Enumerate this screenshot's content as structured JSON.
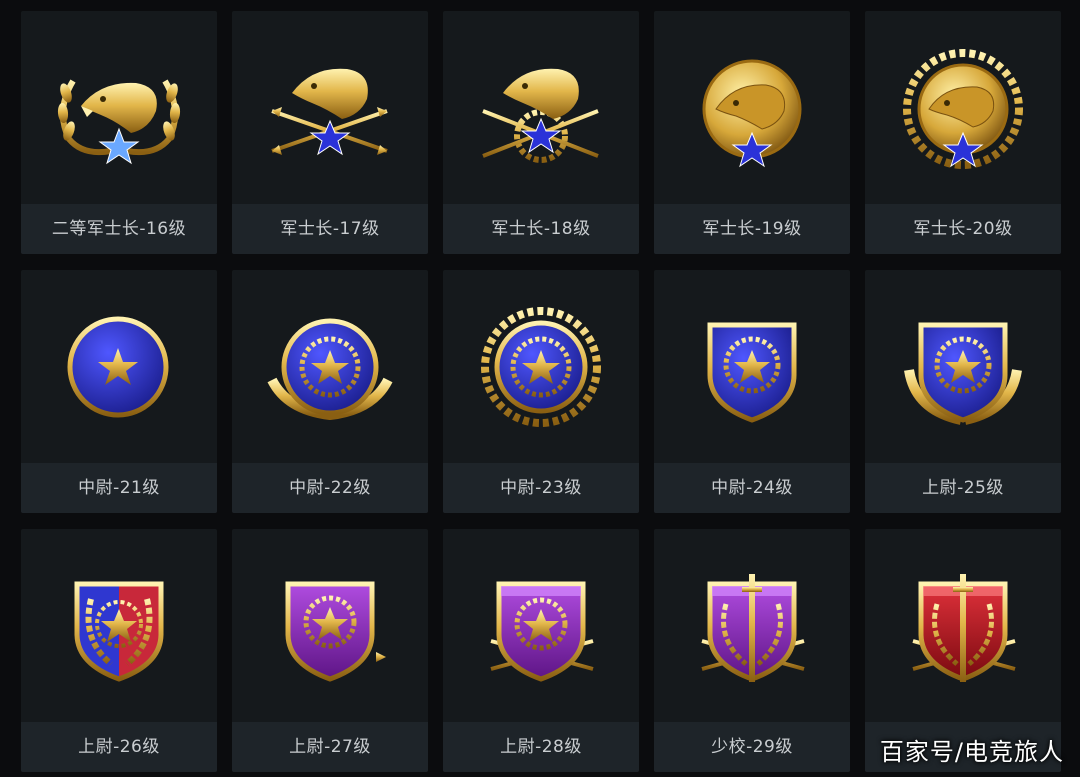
{
  "ranks": [
    {
      "label": "二等军士长-16级",
      "icon": "eagle-wreath-badge-icon"
    },
    {
      "label": "军士长-17级",
      "icon": "eagle-arrows-badge-icon"
    },
    {
      "label": "军士长-18级",
      "icon": "eagle-arrows-gear-badge-icon"
    },
    {
      "label": "军士长-19级",
      "icon": "eagle-gold-coin-badge-icon"
    },
    {
      "label": "军士长-20级",
      "icon": "eagle-gold-wreath-badge-icon"
    },
    {
      "label": "中尉-21级",
      "icon": "blue-circle-star-badge-icon"
    },
    {
      "label": "中尉-22级",
      "icon": "blue-circle-gear-wings-badge-icon"
    },
    {
      "label": "中尉-23级",
      "icon": "blue-circle-gear-wreath-badge-icon"
    },
    {
      "label": "中尉-24级",
      "icon": "blue-shield-gear-badge-icon"
    },
    {
      "label": "上尉-25级",
      "icon": "blue-shield-gear-wings-badge-icon"
    },
    {
      "label": "上尉-26级",
      "icon": "split-shield-wreath-badge-icon"
    },
    {
      "label": "上尉-27级",
      "icon": "purple-shield-arrow-badge-icon"
    },
    {
      "label": "上尉-28级",
      "icon": "purple-castle-shield-arrows-badge-icon"
    },
    {
      "label": "少校-29级",
      "icon": "purple-sword-shield-badge-icon"
    },
    {
      "label": "",
      "icon": "red-sword-shield-badge-icon"
    }
  ],
  "watermark": "百家号/电竞旅人",
  "colors": {
    "background": "#0b0c0e",
    "card": "#15191c",
    "label_bar": "#1e2429",
    "gold": "#e2b64a",
    "blue": "#2a2fb8",
    "purple": "#8a2fb0",
    "red": "#b3121d"
  }
}
